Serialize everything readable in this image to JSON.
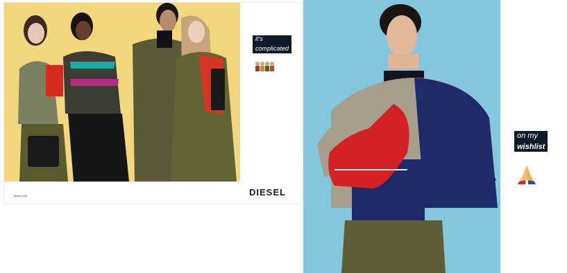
{
  "left_ad": {
    "tag_line1": "it's",
    "tag_line2": "complicated",
    "brand": "DIESEL",
    "site": "diesel.com",
    "emoji": "family-icon",
    "bg_color": "#f2d77e"
  },
  "right_ad": {
    "tag_line1": "on my",
    "tag_line2": "wishlist",
    "emoji": "praying-hands-icon",
    "bg_color": "#84c7dc"
  }
}
